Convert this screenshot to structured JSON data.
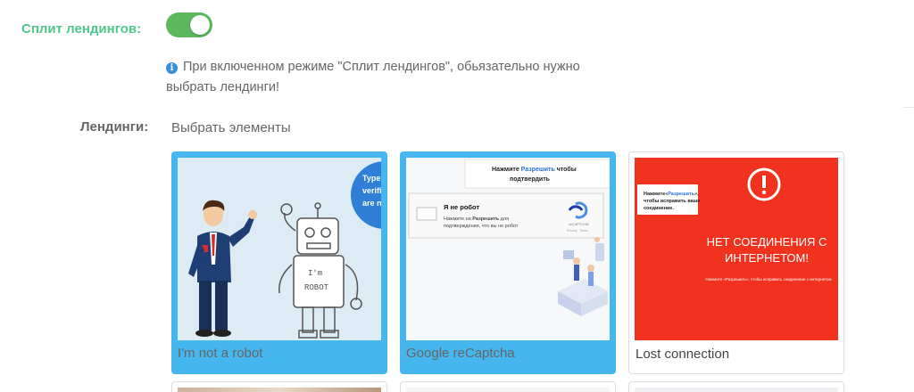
{
  "split": {
    "label": "Сплит лендингов:",
    "enabled": true
  },
  "notice": {
    "text": "При включенном режиме \"Сплит лендингов\", обьязательно нужно выбрать лендинги!"
  },
  "landings": {
    "label": "Лендинги:",
    "placeholder": "Выбрать элементы",
    "items": [
      {
        "title": "I'm not a robot",
        "selected": true
      },
      {
        "title": "Google reCaptcha",
        "selected": true
      },
      {
        "title": "Lost connection",
        "selected": false
      }
    ]
  },
  "thumbs": {
    "robot": {
      "badge_lines": [
        "Type",
        "verifi",
        "are n"
      ],
      "shirt_text": [
        "I'm",
        "ROBOT"
      ]
    },
    "recaptcha": {
      "prompt_prefix": "Нажмите ",
      "prompt_link": "Разрешить",
      "prompt_suffix": " чтобы",
      "prompt_line2": "подтвердить",
      "checkbox_label": "Я не робот",
      "hint_prefix": "Нажмите на ",
      "hint_bold": "Разрешить",
      "hint_suffix": " для",
      "hint_line2": "подтверждения, что вы не робот",
      "brand": "reCAPTCHA",
      "privacy": "Privacy - Terms"
    },
    "lost": {
      "popup_text": "Нажмите «Разрешить», чтобы исправить ваше соединение.",
      "headline_1": "НЕТ СОЕДИНЕНИЯ С",
      "headline_2": "ИНТЕРНЕТОМ!",
      "subtext": "Нажмите «Разрешить», чтобы исправить соединение с интернетом"
    }
  },
  "colors": {
    "accent_green": "#4fc98a",
    "toggle_on": "#5cb85c",
    "selected_blue": "#45b6ee",
    "alert_red": "#f0321e"
  }
}
